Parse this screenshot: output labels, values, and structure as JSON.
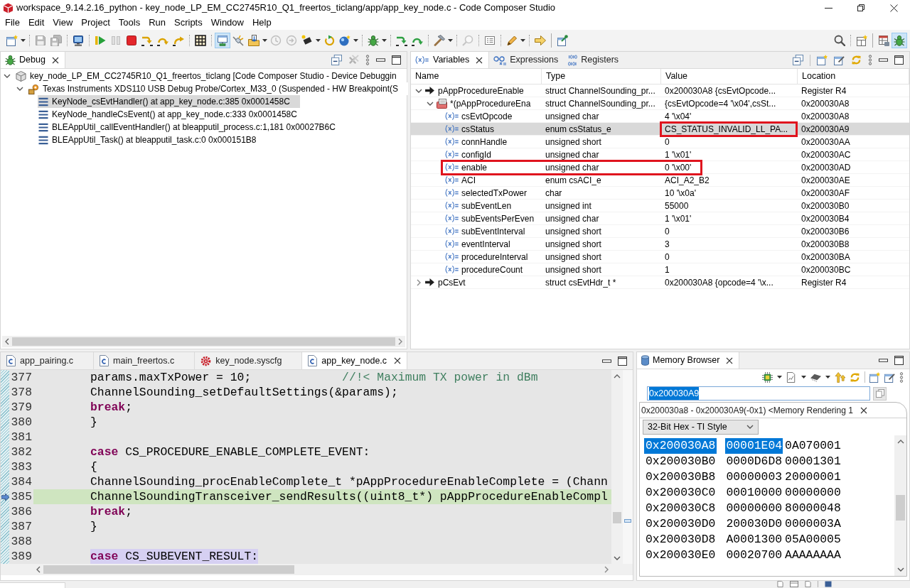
{
  "window": {
    "title": "workspace_9.14.2.16_python - key_node_LP_EM_CC2745R10_Q1_freertos_ticlang/app/app_key_node.c - Code Composer Studio"
  },
  "menu": [
    "File",
    "Edit",
    "View",
    "Project",
    "Tools",
    "Run",
    "Scripts",
    "Window",
    "Help"
  ],
  "toolbar": {
    "left": [
      {
        "kind": "new",
        "dropdown": true,
        "disabled": false,
        "pressed": false
      },
      {
        "kind": "separator"
      },
      {
        "kind": "save",
        "dropdown": false,
        "disabled": true,
        "pressed": false
      },
      {
        "kind": "save_all",
        "dropdown": false,
        "disabled": true,
        "pressed": false
      },
      {
        "kind": "separator"
      },
      {
        "kind": "terminal",
        "dropdown": false,
        "disabled": false,
        "pressed": false
      },
      {
        "kind": "separator"
      },
      {
        "kind": "resume",
        "dropdown": false,
        "disabled": false,
        "pressed": false
      },
      {
        "kind": "suspend",
        "dropdown": false,
        "disabled": true,
        "pressed": false
      },
      {
        "kind": "terminate",
        "dropdown": false,
        "disabled": false,
        "pressed": false
      },
      {
        "kind": "step_into",
        "dropdown": false,
        "disabled": false,
        "pressed": false
      },
      {
        "kind": "step_over",
        "dropdown": false,
        "disabled": false,
        "pressed": false
      },
      {
        "kind": "step_return",
        "dropdown": false,
        "disabled": false,
        "pressed": false
      },
      {
        "kind": "separator"
      },
      {
        "kind": "memory_grid",
        "dropdown": false,
        "disabled": false,
        "pressed": false
      },
      {
        "kind": "separator"
      },
      {
        "kind": "connect",
        "dropdown": false,
        "disabled": false,
        "pressed": true
      },
      {
        "kind": "disconnect",
        "dropdown": false,
        "disabled": false,
        "pressed": false
      },
      {
        "kind": "load",
        "dropdown": true,
        "disabled": false,
        "pressed": false
      },
      {
        "kind": "reset_cpu",
        "dropdown": false,
        "disabled": true,
        "pressed": false
      },
      {
        "kind": "reset_board",
        "dropdown": false,
        "disabled": true,
        "pressed": false
      },
      {
        "kind": "chip",
        "dropdown": true,
        "disabled": false,
        "pressed": false
      },
      {
        "kind": "restart",
        "dropdown": false,
        "disabled": false,
        "pressed": false
      },
      {
        "kind": "sphere",
        "dropdown": true,
        "disabled": false,
        "pressed": false
      },
      {
        "kind": "separator"
      },
      {
        "kind": "debug",
        "dropdown": true,
        "disabled": false,
        "pressed": false
      },
      {
        "kind": "separator"
      },
      {
        "kind": "asm_step_into",
        "dropdown": false,
        "disabled": false,
        "pressed": false
      },
      {
        "kind": "asm_step_over",
        "dropdown": false,
        "disabled": false,
        "pressed": false
      },
      {
        "kind": "separator"
      },
      {
        "kind": "build",
        "dropdown": true,
        "disabled": false,
        "pressed": false
      },
      {
        "kind": "separator"
      },
      {
        "kind": "find",
        "dropdown": false,
        "disabled": true,
        "pressed": false
      },
      {
        "kind": "separator"
      },
      {
        "kind": "views",
        "dropdown": false,
        "disabled": false,
        "pressed": false
      },
      {
        "kind": "separator"
      },
      {
        "kind": "pen",
        "dropdown": true,
        "disabled": false,
        "pressed": false
      },
      {
        "kind": "separator"
      },
      {
        "kind": "next",
        "dropdown": false,
        "disabled": false,
        "pressed": false
      },
      {
        "kind": "bar"
      },
      {
        "kind": "pin_window",
        "dropdown": false,
        "disabled": false,
        "pressed": false
      }
    ],
    "right": [
      {
        "kind": "search",
        "dropdown": false,
        "disabled": false,
        "pressed": false
      },
      {
        "kind": "separator"
      },
      {
        "kind": "open_perspective",
        "dropdown": false,
        "disabled": false,
        "pressed": false
      },
      {
        "kind": "bar"
      },
      {
        "kind": "perspective_table",
        "dropdown": false,
        "disabled": false,
        "pressed": false
      },
      {
        "kind": "perspective_debug",
        "dropdown": false,
        "disabled": false,
        "pressed": true
      }
    ]
  },
  "debug_view": {
    "tab": {
      "label": "Debug"
    },
    "tree": [
      {
        "label": "key_node_LP_EM_CC2745R10_Q1_freertos_ticlang [Code Composer Studio - Device Debuggin",
        "kind": "launch",
        "expanded": true,
        "selected": false,
        "children": [
          {
            "label": "Texas Instruments XDS110 USB Debug Probe/Cortex_M33_0 (Suspended - HW Breakpoint(S",
            "kind": "target",
            "expanded": true,
            "selected": false,
            "children": [
              {
                "label": "KeyNode_csEvtHandler() at app_key_node.c:385 0x0001458C",
                "kind": "frame",
                "selected": true
              },
              {
                "label": "KeyNode_handleCsEvent() at app_key_node.c:333 0x0001458C",
                "kind": "frame",
                "selected": false
              },
              {
                "label": "BLEAppUtil_callEventHandler() at bleapputil_process.c:1,181 0x00027B6C",
                "kind": "frame",
                "selected": false
              },
              {
                "label": "BLEAppUtil_Task() at bleapputil_task.c:0 0x000151B8",
                "kind": "frame",
                "selected": false
              }
            ]
          }
        ]
      }
    ]
  },
  "variables_view": {
    "tabs": [
      {
        "label": "Variables",
        "kind": "variables",
        "selected": true
      },
      {
        "label": "Expressions",
        "kind": "expressions",
        "selected": false
      },
      {
        "label": "Registers",
        "kind": "registers",
        "selected": false
      }
    ],
    "columns": [
      "Name",
      "Type",
      "Value",
      "Location"
    ],
    "rows": [
      {
        "name": "pAppProcedureEnable",
        "type": "struct ChannelSounding_pr...",
        "value": "0x200030A8 {csEvtOpcode...",
        "location": "Register R4",
        "kind": "pointer",
        "expanded": true,
        "selected": false,
        "value_boxed": false,
        "name_to_value_boxed": false,
        "children": [
          {
            "name": "*(pAppProcedureEna",
            "type": "struct ChannelSounding_pr...",
            "value": "{csEvtOpcode=4 '\\x04',csSt...",
            "location": "0x200030A8",
            "kind": "struct",
            "expanded": true,
            "selected": false,
            "value_boxed": false,
            "name_to_value_boxed": false,
            "children": [
              {
                "name": "csEvtOpcode",
                "type": "unsigned char",
                "value": "4 '\\x04'",
                "location": "0x200030A8",
                "kind": "variable",
                "selected": false,
                "value_boxed": false,
                "name_to_value_boxed": false
              },
              {
                "name": "csStatus",
                "type": "enum csStatus_e",
                "value": "CS_STATUS_INVALID_LL_PA...",
                "location": "0x200030A9",
                "kind": "variable",
                "selected": true,
                "value_boxed": true,
                "name_to_value_boxed": false
              },
              {
                "name": "connHandle",
                "type": "unsigned short",
                "value": "0",
                "location": "0x200030AA",
                "kind": "variable",
                "selected": false,
                "value_boxed": false,
                "name_to_value_boxed": false
              },
              {
                "name": "configId",
                "type": "unsigned char",
                "value": "1 '\\x01'",
                "location": "0x200030AC",
                "kind": "variable",
                "selected": false,
                "value_boxed": false,
                "name_to_value_boxed": false
              },
              {
                "name": "enable",
                "type": "unsigned char",
                "value": "0 '\\x00'",
                "location": "0x200030AD",
                "kind": "variable",
                "selected": false,
                "value_boxed": false,
                "name_to_value_boxed": true
              },
              {
                "name": "ACI",
                "type": "enum csACI_e",
                "value": "ACI_A2_B2",
                "location": "0x200030AE",
                "kind": "variable",
                "selected": false,
                "value_boxed": false,
                "name_to_value_boxed": false
              },
              {
                "name": "selectedTxPower",
                "type": "char",
                "value": "10 '\\x0a'",
                "location": "0x200030AF",
                "kind": "variable",
                "selected": false,
                "value_boxed": false,
                "name_to_value_boxed": false
              },
              {
                "name": "subEventLen",
                "type": "unsigned int",
                "value": "55000",
                "location": "0x200030B0",
                "kind": "variable",
                "selected": false,
                "value_boxed": false,
                "name_to_value_boxed": false
              },
              {
                "name": "subEventsPerEven",
                "type": "unsigned char",
                "value": "1 '\\x01'",
                "location": "0x200030B4",
                "kind": "variable",
                "selected": false,
                "value_boxed": false,
                "name_to_value_boxed": false
              },
              {
                "name": "subEventInterval",
                "type": "unsigned short",
                "value": "0",
                "location": "0x200030B6",
                "kind": "variable",
                "selected": false,
                "value_boxed": false,
                "name_to_value_boxed": false
              },
              {
                "name": "eventInterval",
                "type": "unsigned short",
                "value": "3",
                "location": "0x200030B8",
                "kind": "variable",
                "selected": false,
                "value_boxed": false,
                "name_to_value_boxed": false
              },
              {
                "name": "procedureInterval",
                "type": "unsigned short",
                "value": "0",
                "location": "0x200030BA",
                "kind": "variable",
                "selected": false,
                "value_boxed": false,
                "name_to_value_boxed": false
              },
              {
                "name": "procedureCount",
                "type": "unsigned short",
                "value": "1",
                "location": "0x200030BC",
                "kind": "variable",
                "selected": false,
                "value_boxed": false,
                "name_to_value_boxed": false
              }
            ]
          }
        ]
      },
      {
        "name": "pCsEvt",
        "type": "struct csEvtHdr_t *",
        "value": "0x200030A8 {opcode=4 '\\x...",
        "location": "Register R4",
        "kind": "pointer",
        "expanded": false,
        "selected": false,
        "value_boxed": false,
        "name_to_value_boxed": false
      }
    ]
  },
  "editor": {
    "tabs": [
      {
        "label": "app_pairing.c",
        "kind": "c",
        "selected": false
      },
      {
        "label": "main_freertos.c",
        "kind": "c",
        "selected": false
      },
      {
        "label": "key_node.syscfg",
        "kind": "syscfg",
        "selected": false
      },
      {
        "label": "app_key_node.c",
        "kind": "c",
        "selected": true
      }
    ],
    "lines": [
      {
        "number": "377",
        "current": false,
        "occurrence": false,
        "tokens": [
          {
            "kind": "plain",
            "text": "params.maxTxPower = 10;             "
          },
          {
            "kind": "comment",
            "text": "//!< Maximum TX power in dBm"
          }
        ]
      },
      {
        "number": "378",
        "current": false,
        "occurrence": false,
        "tokens": [
          {
            "kind": "plain",
            "text": "ChannelSounding_setDefaultSettings(&params);"
          }
        ]
      },
      {
        "number": "379",
        "current": false,
        "occurrence": false,
        "tokens": [
          {
            "kind": "keyword",
            "text": "break"
          },
          {
            "kind": "plain",
            "text": ";"
          }
        ]
      },
      {
        "number": "380",
        "current": false,
        "occurrence": false,
        "tokens": [
          {
            "kind": "plain",
            "text": "}"
          }
        ]
      },
      {
        "number": "381",
        "current": false,
        "occurrence": false
      },
      {
        "number": "382",
        "current": false,
        "occurrence": false,
        "tokens": [
          {
            "kind": "keyword",
            "text": "case"
          },
          {
            "kind": "plain",
            "text": " CS_PROCEDURE_ENABLE_COMPLETE_EVENT:"
          }
        ]
      },
      {
        "number": "383",
        "current": false,
        "occurrence": false,
        "tokens": [
          {
            "kind": "plain",
            "text": "{"
          }
        ]
      },
      {
        "number": "384",
        "current": false,
        "occurrence": false,
        "tokens": [
          {
            "kind": "plain",
            "text": "ChannelSounding_procEnableComplete_t *pAppProcedureEnableComplete = (Chann"
          }
        ]
      },
      {
        "number": "385",
        "current": true,
        "occurrence": false,
        "tokens": [
          {
            "kind": "plain",
            "text": "ChannelSoundingTransceiver_sendResults((uint8_t*) pAppProcedureEnableCompl"
          }
        ]
      },
      {
        "number": "386",
        "current": false,
        "occurrence": false,
        "tokens": [
          {
            "kind": "keyword",
            "text": "break"
          },
          {
            "kind": "plain",
            "text": ";"
          }
        ]
      },
      {
        "number": "387",
        "current": false,
        "occurrence": false,
        "tokens": [
          {
            "kind": "plain",
            "text": "}"
          }
        ]
      },
      {
        "number": "388",
        "current": false,
        "occurrence": false
      },
      {
        "number": "389",
        "current": false,
        "occurrence": true,
        "tokens": [
          {
            "kind": "keyword",
            "text": "case"
          },
          {
            "kind": "plain",
            "text": " CS_SUBEVENT_RESULT:"
          }
        ]
      }
    ]
  },
  "memory_browser": {
    "tab": {
      "label": "Memory Browser"
    },
    "address": {
      "value": "0x200030A9",
      "selected": true
    },
    "rendering": {
      "label": "0x200030a8 - 0x200030A9(-0x1) <Memory Rendering 1",
      "format": "32-Bit Hex - TI Style"
    },
    "rows": [
      {
        "address": "0x200030A8",
        "selected": true,
        "words": [
          {
            "value": "00001E04",
            "selected": true
          },
          {
            "value": "0A070001",
            "selected": false
          }
        ]
      },
      {
        "address": "0x200030B0",
        "selected": false,
        "words": [
          {
            "value": "0000D6D8",
            "selected": false
          },
          {
            "value": "00001301",
            "selected": false
          }
        ]
      },
      {
        "address": "0x200030B8",
        "selected": false,
        "words": [
          {
            "value": "00000003",
            "selected": false
          },
          {
            "value": "20000001",
            "selected": false
          }
        ]
      },
      {
        "address": "0x200030C0",
        "selected": false,
        "words": [
          {
            "value": "00010000",
            "selected": false
          },
          {
            "value": "00000000",
            "selected": false
          }
        ]
      },
      {
        "address": "0x200030C8",
        "selected": false,
        "words": [
          {
            "value": "00000000",
            "selected": false
          },
          {
            "value": "80000048",
            "selected": false
          }
        ]
      },
      {
        "address": "0x200030D0",
        "selected": false,
        "words": [
          {
            "value": "200030D0",
            "selected": false
          },
          {
            "value": "0000003A",
            "selected": false
          }
        ]
      },
      {
        "address": "0x200030D8",
        "selected": false,
        "words": [
          {
            "value": "A0001300",
            "selected": false
          },
          {
            "value": "05A00005",
            "selected": false
          }
        ]
      },
      {
        "address": "0x200030E0",
        "selected": false,
        "words": [
          {
            "value": "00020700",
            "selected": false
          },
          {
            "value": "AAAAAAAA",
            "selected": false
          }
        ]
      }
    ]
  }
}
